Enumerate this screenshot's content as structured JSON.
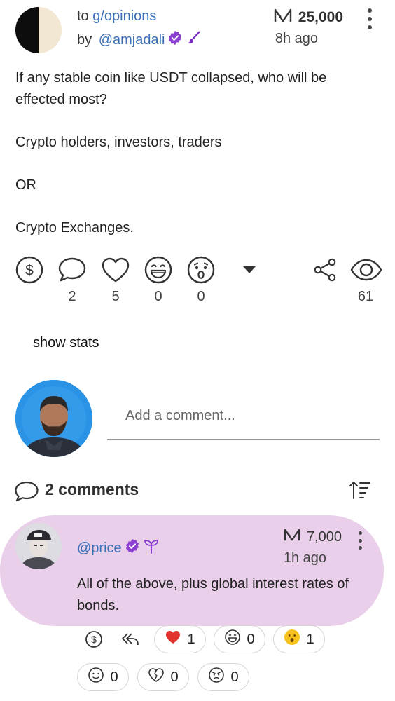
{
  "post": {
    "group_prefix": "to ",
    "group_name": "g/opinions",
    "author_prefix": "by ",
    "author": "@amjadali",
    "points": "25,000",
    "time": "8h ago",
    "body": [
      "If any stable coin like USDT collapsed, who will be effected most?",
      "Crypto holders, investors, traders",
      "OR",
      "Crypto Exchanges."
    ],
    "actions": {
      "comments_count": "2",
      "likes_count": "5",
      "laugh_count": "0",
      "wow_count": "0",
      "views_count": "61"
    },
    "show_stats_label": "show stats"
  },
  "comment_box": {
    "placeholder": "Add a comment..."
  },
  "comments": {
    "title": "2 comments",
    "items": [
      {
        "user": "@price",
        "points": "7,000",
        "time": "1h ago",
        "text": "All of the above, plus global interest rates of bonds.",
        "reactions": {
          "heart": "1",
          "laugh": "0",
          "wow": "1",
          "smile": "0",
          "heartbreak": "0",
          "angry": "0"
        }
      }
    ]
  },
  "colors": {
    "link": "#3b6fb6",
    "verified_badge": "#8a3fd1",
    "comment_bg": "#e9cfe9",
    "avatar_bg": "#1e8be0"
  },
  "icons": [
    "tip-dollar-icon",
    "comment-bubble-icon",
    "heart-icon",
    "laugh-icon",
    "wow-icon",
    "caret-down-icon",
    "share-icon",
    "eye-icon",
    "sort-icon",
    "reply-icon",
    "verified-badge-icon",
    "brush-icon",
    "sprout-icon",
    "points-logo-icon"
  ]
}
